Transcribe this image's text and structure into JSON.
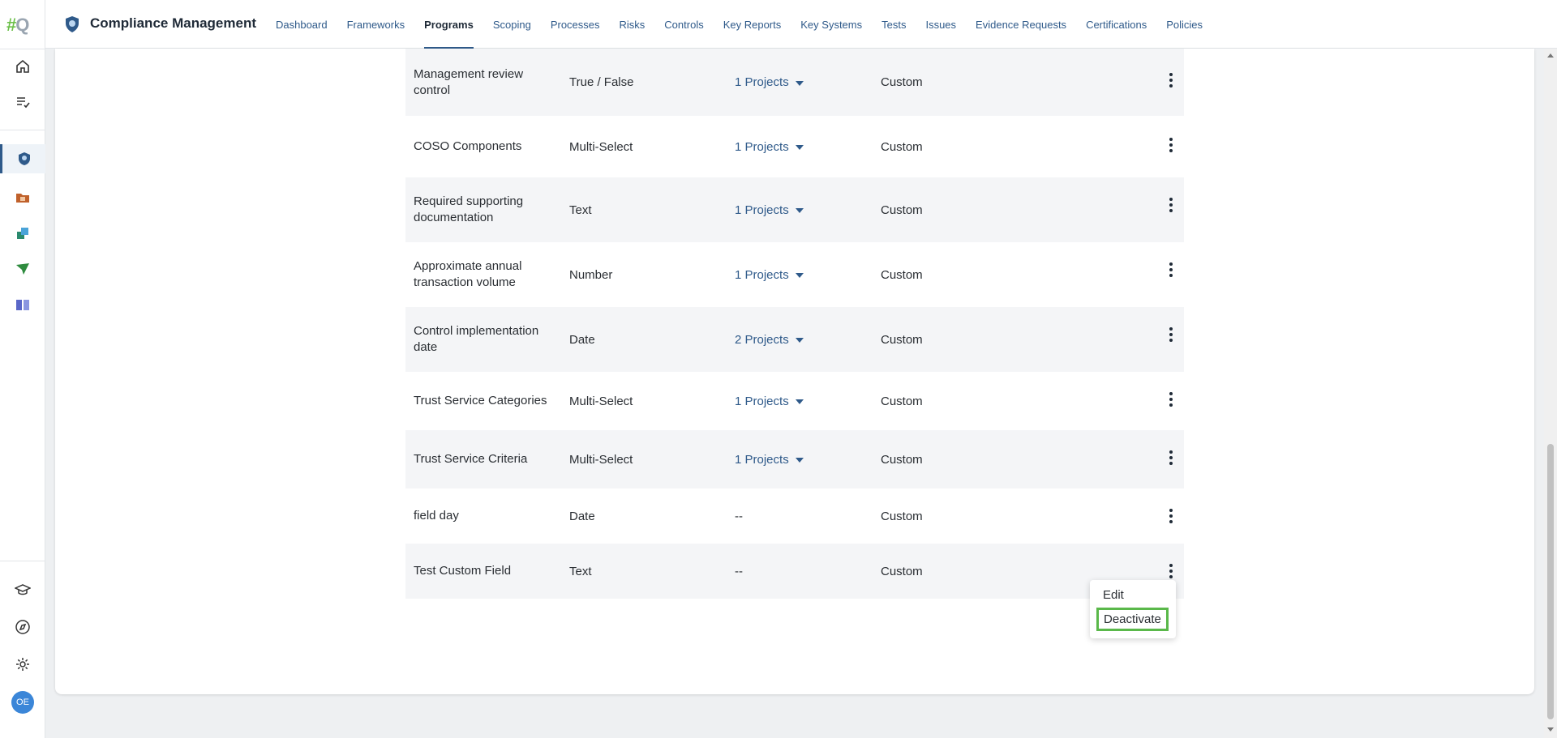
{
  "logo": {
    "hash": "#",
    "letter": "Q"
  },
  "app": {
    "title": "Compliance Management",
    "icon": "shield-badge-icon"
  },
  "nav": [
    {
      "label": "Dashboard",
      "active": false
    },
    {
      "label": "Frameworks",
      "active": false
    },
    {
      "label": "Programs",
      "active": true
    },
    {
      "label": "Scoping",
      "active": false
    },
    {
      "label": "Processes",
      "active": false
    },
    {
      "label": "Risks",
      "active": false
    },
    {
      "label": "Controls",
      "active": false
    },
    {
      "label": "Key Reports",
      "active": false
    },
    {
      "label": "Key Systems",
      "active": false
    },
    {
      "label": "Tests",
      "active": false
    },
    {
      "label": "Issues",
      "active": false
    },
    {
      "label": "Evidence Requests",
      "active": false
    },
    {
      "label": "Certifications",
      "active": false
    },
    {
      "label": "Policies",
      "active": false
    }
  ],
  "rail": {
    "top_icons": [
      "home-icon",
      "task-list-icon"
    ],
    "app_icons": [
      "compliance-shield-icon",
      "folder-icon",
      "sync-servers-icon",
      "paper-plane-icon",
      "book-icon"
    ],
    "bottom_icons": [
      "graduation-cap-icon",
      "compass-icon",
      "gear-icon"
    ],
    "avatar_initials": "OE"
  },
  "rows": [
    {
      "name": "Management review control",
      "type": "True / False",
      "projects": "1 Projects",
      "has_projects": true,
      "source": "Custom"
    },
    {
      "name": "COSO Components",
      "type": "Multi-Select",
      "projects": "1 Projects",
      "has_projects": true,
      "source": "Custom"
    },
    {
      "name": "Required supporting documentation",
      "type": "Text",
      "projects": "1 Projects",
      "has_projects": true,
      "source": "Custom"
    },
    {
      "name": "Approximate annual transaction volume",
      "type": "Number",
      "projects": "1 Projects",
      "has_projects": true,
      "source": "Custom"
    },
    {
      "name": "Control implementation date",
      "type": "Date",
      "projects": "2 Projects",
      "has_projects": true,
      "source": "Custom"
    },
    {
      "name": "Trust Service Categories",
      "type": "Multi-Select",
      "projects": "1 Projects",
      "has_projects": true,
      "source": "Custom"
    },
    {
      "name": "Trust Service Criteria",
      "type": "Multi-Select",
      "projects": "1 Projects",
      "has_projects": true,
      "source": "Custom"
    },
    {
      "name": "field day",
      "type": "Date",
      "projects": "--",
      "has_projects": false,
      "source": "Custom"
    },
    {
      "name": "Test Custom Field",
      "type": "Text",
      "projects": "--",
      "has_projects": false,
      "source": "Custom"
    }
  ],
  "popup": {
    "edit_label": "Edit",
    "deactivate_label": "Deactivate"
  },
  "colors": {
    "accent": "#2f5a8a",
    "highlight": "#5ab84a",
    "row_shade": "#f4f5f7"
  }
}
